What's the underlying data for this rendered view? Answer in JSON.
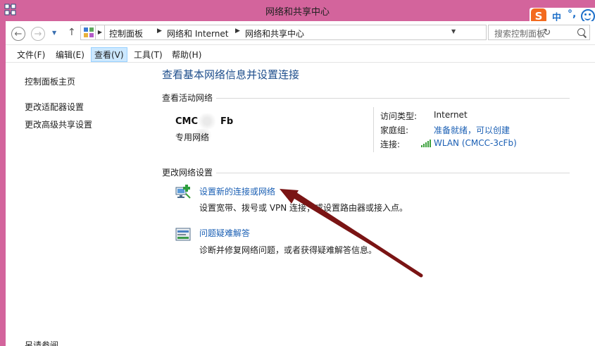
{
  "window": {
    "title": "网络和共享中心"
  },
  "ime": {
    "logo": "S",
    "mode": "中",
    "punct": "°,"
  },
  "nav": {
    "back": "←",
    "forward": "→",
    "up": "↑",
    "breadcrumbs": [
      "控制面板",
      "网络和 Internet",
      "网络和共享中心"
    ],
    "search_placeholder": "搜索控制面板"
  },
  "menu": [
    "文件(F)",
    "编辑(E)",
    "查看(V)",
    "工具(T)",
    "帮助(H)"
  ],
  "sidebar": {
    "home": "控制面板主页",
    "links": [
      "更改适配器设置",
      "更改高级共享设置"
    ],
    "see_also": "另请参阅"
  },
  "main": {
    "title": "查看基本网络信息并设置连接",
    "active_title": "查看活动网络",
    "network": {
      "name_left": "CMC",
      "name_right": "Fb",
      "type": "专用网络",
      "access_label": "访问类型:",
      "access_value": "Internet",
      "homegroup_label": "家庭组:",
      "homegroup_value": "准备就绪，可以创建",
      "connection_label": "连接:",
      "connection_value": "WLAN (CMCC-3cFb)"
    },
    "change_title": "更改网络设置",
    "tasks": [
      {
        "title": "设置新的连接或网络",
        "desc": "设置宽带、拨号或 VPN 连接；或设置路由器或接入点。"
      },
      {
        "title": "问题疑难解答",
        "desc": "诊断并修复网络问题，或者获得疑难解答信息。"
      }
    ]
  },
  "colors": {
    "titlebar": "#d3649c",
    "link": "#1a5fb4",
    "arrow": "#7a1414"
  }
}
